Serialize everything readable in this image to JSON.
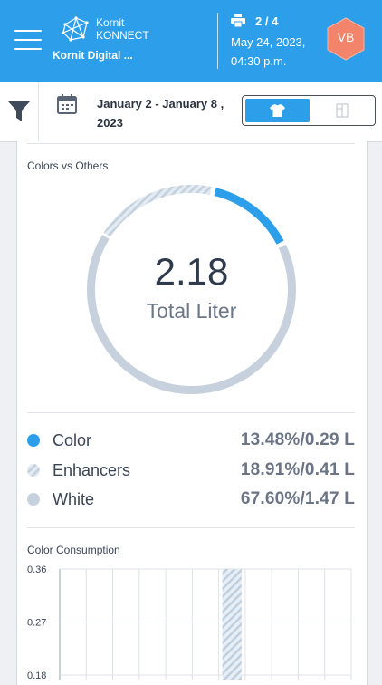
{
  "header": {
    "brand_line1": "Kornit",
    "brand_line2": "KONNECT",
    "brand_sub": "Kornit Digital ...",
    "device_count": "2 / 4",
    "date": "May 24, 2023,",
    "time": "04:30 p.m.",
    "avatar_initials": "VB",
    "avatar_color": "#f2846b",
    "accent": "#2d9fea",
    "icons": [
      "menu-icon",
      "kornit-logo-icon",
      "printer-icon"
    ]
  },
  "filterbar": {
    "date_range": "January 2 - January 8 , 2023",
    "icons": [
      "filter-icon",
      "calendar-icon",
      "tshirt-icon",
      "roll-icon"
    ],
    "toggle_selected": "tshirt"
  },
  "colors_vs_others": {
    "title": "Colors vs Others",
    "total_value": "2.18",
    "total_label": "Total Liter",
    "legend": [
      {
        "label": "Color",
        "value": "13.48%/0.29 L",
        "color": "#2d9fea",
        "pattern": "solid"
      },
      {
        "label": "Enhancers",
        "value": "18.91%/0.41 L",
        "color": "#c8d4e2",
        "pattern": "striped"
      },
      {
        "label": "White",
        "value": "67.60%/1.47 L",
        "color": "#c7d1dd",
        "pattern": "solid"
      }
    ]
  },
  "chart_data": [
    {
      "type": "pie",
      "categories": [
        "Color",
        "Enhancers",
        "White"
      ],
      "values": [
        13.48,
        18.91,
        67.6
      ]
    },
    {
      "type": "bar",
      "title": "Color Consumption",
      "y_ticks": [
        "0.36",
        "0.27",
        "0.18"
      ],
      "ylim": [
        0.18,
        0.36
      ],
      "series": [
        {
          "values": [
            0,
            0,
            0,
            0,
            0,
            0,
            0.36,
            0,
            0,
            0,
            0
          ],
          "pattern": "striped"
        }
      ]
    }
  ]
}
